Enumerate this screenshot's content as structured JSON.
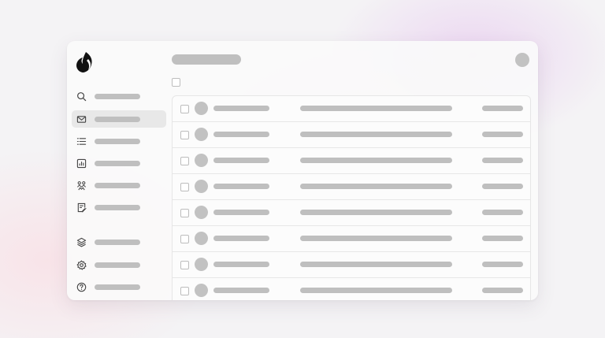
{
  "theme": {
    "placeholder_color": "#bfbfbf",
    "window_bg": "#fafafa",
    "active_item_bg": "#e8e8e8"
  },
  "sidebar": {
    "logo": "flame-logo",
    "items": [
      {
        "icon": "search-icon",
        "active": false
      },
      {
        "icon": "mail-icon",
        "active": true
      },
      {
        "icon": "list-icon",
        "active": false
      },
      {
        "icon": "bar-chart-icon",
        "active": false
      },
      {
        "icon": "team-icon",
        "active": false
      },
      {
        "icon": "notes-icon",
        "active": false
      },
      {
        "icon": "layers-icon",
        "active": false
      },
      {
        "icon": "settings-icon",
        "active": false
      },
      {
        "icon": "help-icon",
        "active": false
      }
    ]
  },
  "header": {
    "avatar": "user-avatar"
  },
  "message_list": {
    "row_count": 8,
    "columns": [
      "checkbox",
      "avatar",
      "sender",
      "subject",
      "date"
    ]
  }
}
